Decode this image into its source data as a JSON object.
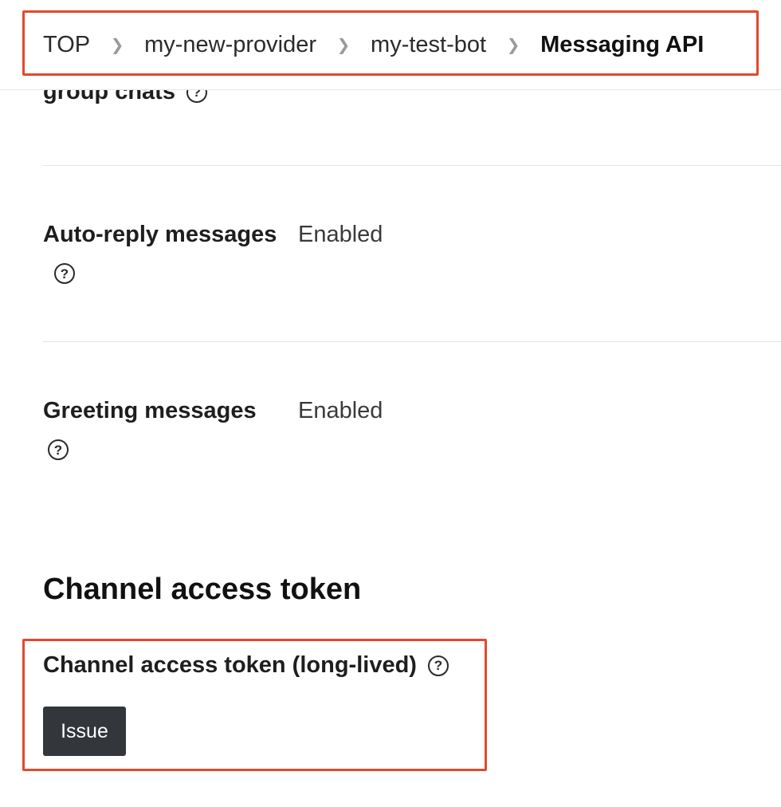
{
  "breadcrumb": {
    "items": [
      "TOP",
      "my-new-provider",
      "my-test-bot"
    ],
    "current": "Messaging API",
    "separator": ">"
  },
  "settings": {
    "partial_label": "group chats",
    "rows": [
      {
        "label": "Auto-reply messages",
        "value": "Enabled"
      },
      {
        "label": "Greeting messages",
        "value": "Enabled"
      }
    ]
  },
  "channel_access_token": {
    "section_title": "Channel access token",
    "field_label": "Channel access token (long-lived)",
    "issue_button": "Issue"
  },
  "icons": {
    "help": "help-question-circle-icon",
    "breadcrumb_separator": "chevron-right-icon"
  },
  "colors": {
    "highlight": "#e04a2f",
    "button_bg": "#33363b"
  }
}
